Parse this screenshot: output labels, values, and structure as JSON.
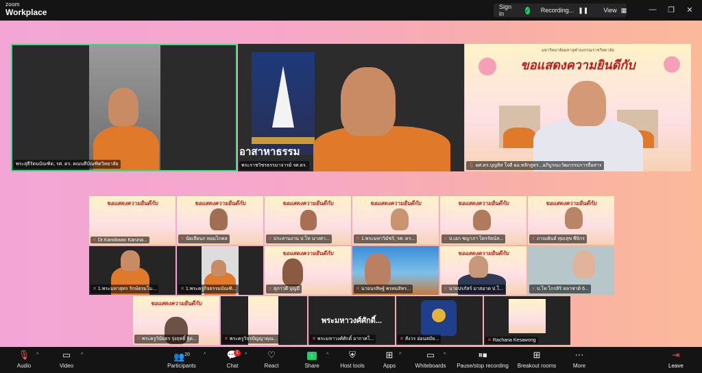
{
  "app": {
    "brand_small": "zoom",
    "brand_large": "Workplace"
  },
  "titlebar": {
    "sign_in": "Sign in",
    "recording": "Recording...",
    "view": "View"
  },
  "main_tiles": [
    {
      "label": "พระสุธีรัตนบัณฑิต, รศ. ดร. คณบดีบัณฑิตวิทยาลัย"
    },
    {
      "label": "พระราชวิชรธรรมาจารย์ รศ.ดร.",
      "banner": "อาสาหาธรรม"
    },
    {
      "label": "ผศ.ดร.บุญสิส ใจดี ผอ.หลักสูตร...อภิบูรณะวัฒกรรมการสื่อสาร"
    }
  ],
  "poster_title": "ขอแสดงความยินดีกับ",
  "poster_header": "มหาวิทยาลัยมหาจุฬาลงกรณราชวิทยาลัย",
  "grid": [
    {
      "label": "Dr.Kanokwan Karuna..."
    },
    {
      "label": "นัยเลียนก หอมไกคล"
    },
    {
      "label": "ประสานงาน ป.โท นางสา..."
    },
    {
      "label": "1.พระมหาวิมัชร์, รศ. ดร..."
    },
    {
      "label": "ป.เอก ชญาภา ไตรรัตน์ส..."
    },
    {
      "label": "ภาณพันธ์ ทุมเสุข พีจิกร"
    },
    {
      "label": "1.พระมหาสุทร รักษ์ธรมโม..."
    },
    {
      "label": "1.พระครูกิจธรรมบัณฑิ..."
    },
    {
      "label": "สุภาวดี บุญมี"
    },
    {
      "label": "นายนรสิษฐ์ พรหมสิทร..."
    },
    {
      "label": "นายปรภัสร์ มาสอาด ป.โ..."
    },
    {
      "label": "ป.โท ไกรสิริ หลาชาติ 6..."
    },
    {
      "label": "พระครูวินัยธร รุ่งฤทธิ์ ฐิต..."
    },
    {
      "label": "พระครูวิจรปัญญาคุณ..."
    },
    {
      "label": "พระมหาวงศ์ศักดิ์ อากาศโ...",
      "name": "พระมหาวงศ์ศักดิ์..."
    },
    {
      "label": "สังวร อ่อนสมัย..."
    },
    {
      "label": "Rachana Kesawong"
    }
  ],
  "toolbar": {
    "audio": "Audio",
    "video": "Video",
    "participants": "Participants",
    "participants_count": "20",
    "chat": "Chat",
    "chat_badge": "1",
    "react": "React",
    "share": "Share",
    "host_tools": "Host tools",
    "apps": "Apps",
    "whiteboards": "Whiteboards",
    "recording": "Pause/stop recording",
    "breakout": "Breakout rooms",
    "more": "More",
    "leave": "Leave"
  },
  "colors": {
    "stage_pink": "#f3a6d6",
    "stage_peach": "#fcb99a",
    "active_border": "#3ddc84",
    "recording_red": "#ff3b30",
    "share_green": "#1fcf6b"
  }
}
